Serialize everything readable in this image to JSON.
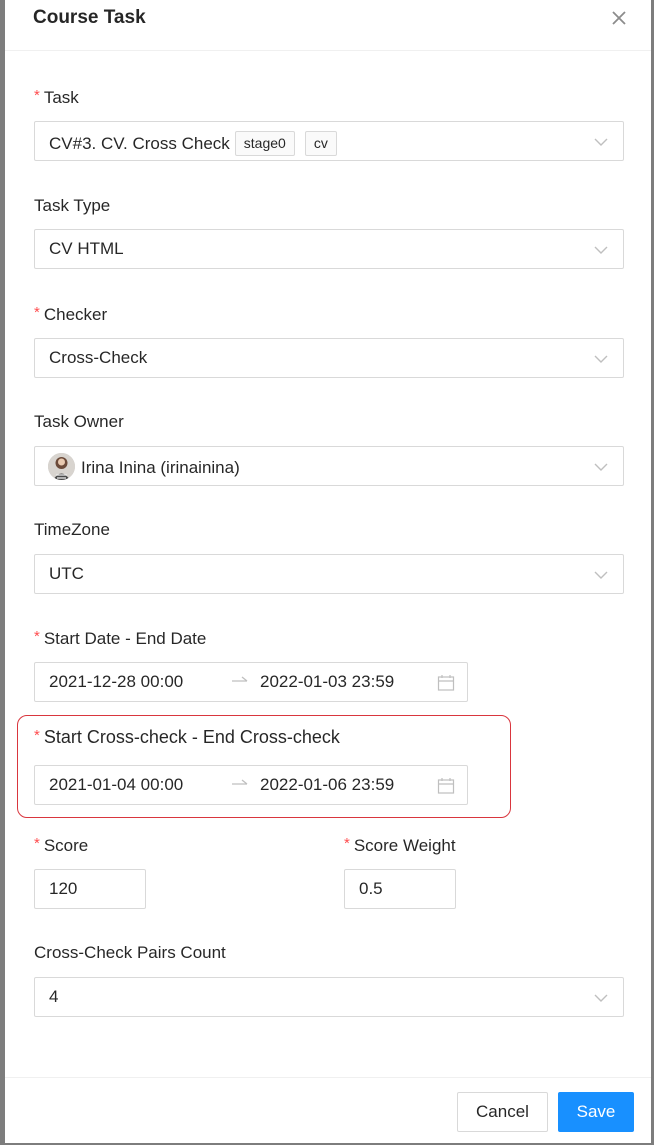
{
  "modal": {
    "title": "Course Task"
  },
  "fields": {
    "task": {
      "label": "Task",
      "value": "CV#3. CV. Cross Check",
      "tags": [
        "stage0",
        "cv"
      ]
    },
    "task_type": {
      "label": "Task Type",
      "value": "CV HTML"
    },
    "checker": {
      "label": "Checker",
      "value": "Cross-Check"
    },
    "task_owner": {
      "label": "Task Owner",
      "value": "Irina Inina (irinainina)"
    },
    "timezone": {
      "label": "TimeZone",
      "value": "UTC"
    },
    "dates": {
      "label": "Start Date - End Date",
      "start": "2021-12-28 00:00",
      "end": "2022-01-03 23:59"
    },
    "cross_check_dates": {
      "label": "Start Cross-check - End Cross-check",
      "start": "2021-01-04 00:00",
      "end": "2022-01-06 23:59"
    },
    "score": {
      "label": "Score",
      "value": "120"
    },
    "score_weight": {
      "label": "Score Weight",
      "value": "0.5"
    },
    "pairs_count": {
      "label": "Cross-Check Pairs Count",
      "value": "4"
    }
  },
  "footer": {
    "cancel_label": "Cancel",
    "save_label": "Save"
  },
  "colors": {
    "primary": "#1890ff",
    "required_mark": "#ff4d4f",
    "highlight_border": "#d9363e"
  },
  "icons": [
    "close-icon",
    "chevron-down-icon",
    "arrow-right-icon",
    "calendar-icon",
    "avatar"
  ]
}
